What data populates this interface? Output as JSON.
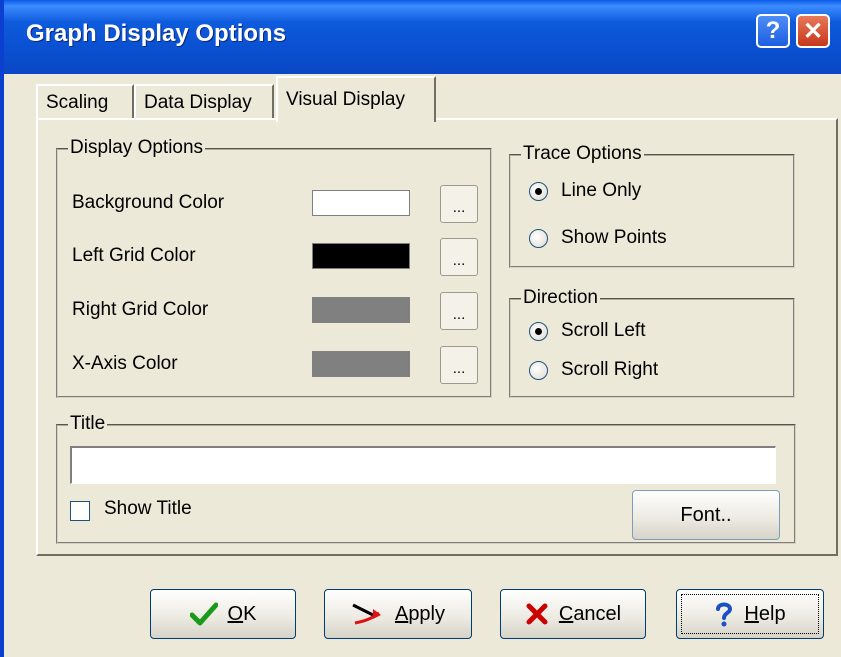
{
  "window": {
    "title": "Graph Display Options",
    "help_glyph": "?",
    "close_glyph": "✕"
  },
  "tabs": [
    {
      "label": "Scaling"
    },
    {
      "label": "Data Display"
    },
    {
      "label": "Visual Display",
      "active": true
    }
  ],
  "display_options": {
    "legend": "Display Options",
    "rows": [
      {
        "label": "Background Color",
        "color": "#ffffff",
        "button": "..."
      },
      {
        "label": "Left Grid Color",
        "color": "#000000",
        "button": "..."
      },
      {
        "label": "Right Grid Color",
        "color": "#808080",
        "button": "..."
      },
      {
        "label": "X-Axis Color",
        "color": "#808080",
        "button": "..."
      }
    ]
  },
  "trace_options": {
    "legend": "Trace Options",
    "options": [
      {
        "label": "Line Only",
        "selected": true
      },
      {
        "label": "Show Points",
        "selected": false
      }
    ]
  },
  "direction": {
    "legend": "Direction",
    "options": [
      {
        "label": "Scroll Left",
        "selected": true
      },
      {
        "label": "Scroll Right",
        "selected": false
      }
    ]
  },
  "title_group": {
    "legend": "Title",
    "value": "",
    "show_title_label": "Show Title",
    "show_title_checked": false,
    "font_button": "Font.."
  },
  "buttons": {
    "ok_accel": "O",
    "ok_rest": "K",
    "apply_accel": "A",
    "apply_rest": "pply",
    "cancel_accel": "C",
    "cancel_rest": "ancel",
    "help_accel": "H",
    "help_rest": "elp"
  }
}
